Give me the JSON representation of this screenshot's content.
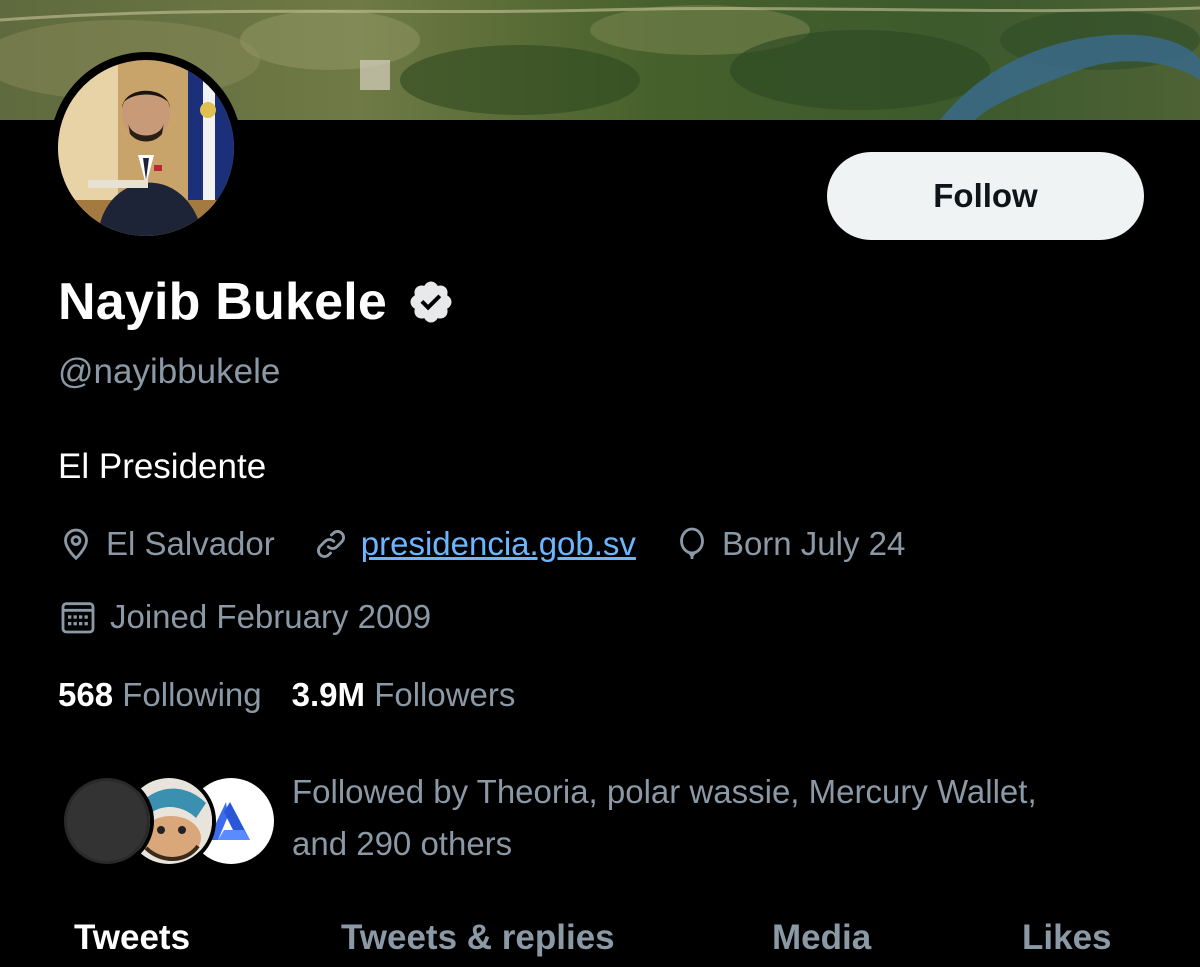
{
  "profile": {
    "name": "Nayib Bukele",
    "handle": "@nayibbukele",
    "bio": "El Presidente",
    "location": "El Salvador",
    "website": "presidencia.gob.sv",
    "birthday": "Born July 24",
    "joined": "Joined February 2009",
    "verified": true
  },
  "actions": {
    "follow_label": "Follow"
  },
  "stats": {
    "following_count": "568",
    "following_label": "Following",
    "followers_count": "3.9M",
    "followers_label": "Followers"
  },
  "followed_by": {
    "text": "Followed by Theoria, polar wassie, Mercury Wallet, and 290 others"
  },
  "tabs": [
    {
      "label": "Tweets",
      "active": true
    },
    {
      "label": "Tweets & replies",
      "active": false
    },
    {
      "label": "Media",
      "active": false
    },
    {
      "label": "Likes",
      "active": false
    }
  ],
  "icons": {
    "location": "map-pin-icon",
    "link": "link-icon",
    "birthday": "balloon-icon",
    "joined": "calendar-icon",
    "verified": "verified-badge-icon"
  },
  "colors": {
    "background": "#000000",
    "text_primary": "#ffffff",
    "text_secondary": "#8b98a5",
    "link": "#6cb6ff",
    "follow_button_bg": "#eff3f4"
  }
}
